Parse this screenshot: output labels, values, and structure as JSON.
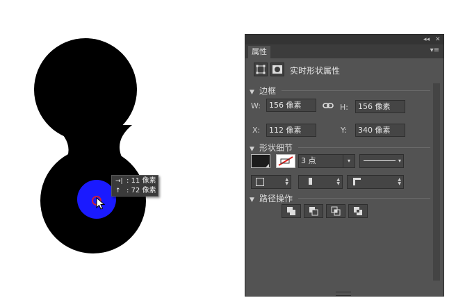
{
  "canvas": {
    "shape_color": "#000000",
    "circle_color": "#1a1aff",
    "marker_color": "#cc1f3a"
  },
  "tooltip": {
    "line1_icon": "→|",
    "line1_text": "11 像素",
    "line2_icon": "↑",
    "line2_text": "72 像素"
  },
  "panel": {
    "tab_label": "属性",
    "menu_icon": "panel-menu-icon",
    "top_buttons": [
      "collapse-icon",
      "close-icon"
    ],
    "live_shape_label": "实时形状属性",
    "section_bounds": "边框",
    "w_label": "W:",
    "w_value": "156 像素",
    "h_label": "H:",
    "h_value": "156 像素",
    "x_label": "X:",
    "x_value": "112 像素",
    "y_label": "Y:",
    "y_value": "340 像素",
    "section_shape": "形状细节",
    "stroke_width": "3 点",
    "section_path": "路径操作"
  }
}
